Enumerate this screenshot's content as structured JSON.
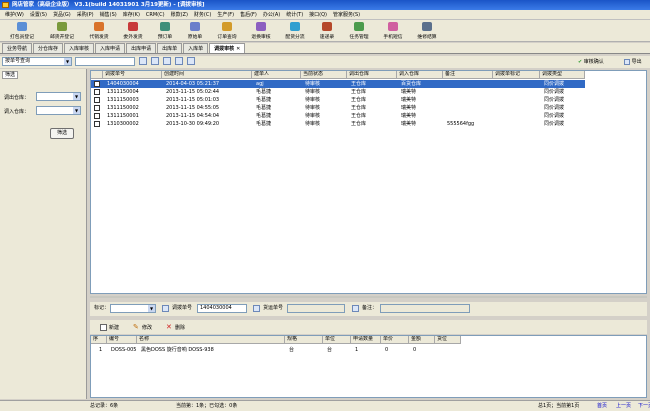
{
  "window": {
    "title": "网店管家（高级企业版） V3.1(build 14031901 3月19更新) - [调拨审核]"
  },
  "menu": [
    "维护(W)",
    "设置(S)",
    "货品(G)",
    "采购(P)",
    "销售(S)",
    "库存(K)",
    "CRM(C)",
    "账款(Z)",
    "财务(C)",
    "生产(F)",
    "售后(F)",
    "办公(A)",
    "统计(T)",
    "接口(Q)",
    "管家服务(S)"
  ],
  "toolbar": [
    {
      "label": "打包员登记",
      "color": "#5b8fd6"
    },
    {
      "label": "邮货开登记",
      "color": "#7a9a3c"
    },
    {
      "label": "代销发货",
      "color": "#d9732a"
    },
    {
      "label": "委外发货",
      "color": "#c83a3a"
    },
    {
      "label": "预订单",
      "color": "#3f8f7a"
    },
    {
      "label": "原始单",
      "color": "#6b7ecb"
    },
    {
      "label": "订单查询",
      "color": "#d39b2a"
    },
    {
      "label": "退换审核",
      "color": "#8c5fc0"
    },
    {
      "label": "配货分流",
      "color": "#2f9fd0"
    },
    {
      "label": "速递录",
      "color": "#b5482a"
    },
    {
      "label": "任务管理",
      "color": "#4c9b4c"
    },
    {
      "label": "手机短信",
      "color": "#d05fa0"
    },
    {
      "label": "维修结算",
      "color": "#5a6f8c"
    }
  ],
  "subtabs": [
    {
      "label": "业务导航",
      "active": false
    },
    {
      "label": "分仓库存",
      "active": false
    },
    {
      "label": "入库审核",
      "active": false
    },
    {
      "label": "入库申请",
      "active": false
    },
    {
      "label": "出库申请",
      "active": false
    },
    {
      "label": "出库单",
      "active": false
    },
    {
      "label": "入库单",
      "active": false
    },
    {
      "label": "调拨审核",
      "active": true
    }
  ],
  "filter": {
    "query_combo": "按单号查询",
    "approve_label": "审核确认",
    "export_label": "导出"
  },
  "left_panel": {
    "tab": "筛选",
    "out_wh_label": "调出仓库：",
    "in_wh_label": "调入仓库：",
    "filter_button": "筛选"
  },
  "grid": {
    "columns": [
      "调拨单号",
      "创建时间",
      "建单人",
      "当前状态",
      "调出仓库",
      "调入仓库",
      "备注",
      "调拨单标记",
      "调拨类型"
    ],
    "rows": [
      [
        "1404030004",
        "2014-04-03  05:21:37",
        "agj",
        "待审核",
        "王仓库",
        "百货仓库",
        "",
        "",
        "同价调拨"
      ],
      [
        "1311150004",
        "2013-11-15  05:02:44",
        "毛葛捷",
        "待审核",
        "王仓库",
        "瑞美特",
        "",
        "",
        "同价调拨"
      ],
      [
        "1311150003",
        "2013-11-15  05:01:03",
        "毛葛捷",
        "待审核",
        "王仓库",
        "瑞美特",
        "",
        "",
        "同价调拨"
      ],
      [
        "1311150002",
        "2013-11-15  04:55:05",
        "毛葛捷",
        "待审核",
        "王仓库",
        "瑞美特",
        "",
        "",
        "同价调拨"
      ],
      [
        "1311150001",
        "2013-11-15  04:54:04",
        "毛葛捷",
        "待审核",
        "王仓库",
        "瑞美特",
        "",
        "",
        "同价调拨"
      ],
      [
        "1310300002",
        "2013-10-30  09:49:20",
        "毛葛捷",
        "待审核",
        "王仓库",
        "瑞美特",
        "555564fgg",
        "",
        "同价调拨"
      ]
    ]
  },
  "detail": {
    "mark_label": "标记：",
    "order_no_label": "调拨单号",
    "order_no": "1404030004",
    "ship_no_label": "货运单号",
    "ship_no": "",
    "remark_label": "备注：",
    "remark": ""
  },
  "actions": {
    "new": "新建",
    "edit": "修改",
    "delete": "删除"
  },
  "grid2": {
    "columns": [
      "序",
      "编号",
      "名称",
      "规格",
      "单位",
      "申请数量",
      "单价",
      "金额",
      "货位"
    ],
    "rows": [
      [
        "1",
        "DOSS-005",
        "黑色DOSS 旋行音响 DOSS-938",
        "台",
        "台",
        "1",
        "0",
        "0",
        ""
      ]
    ]
  },
  "status": {
    "total": "总记录：6条",
    "current": "当前第：1条；已勾选：0条",
    "pages": "总1页；当前第1页",
    "first": "首页",
    "prev": "上一页",
    "next": "下一页"
  }
}
